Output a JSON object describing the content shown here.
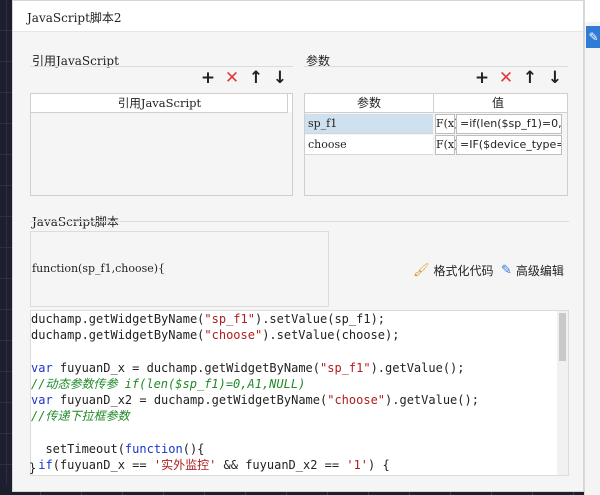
{
  "dialog": {
    "title": "JavaScript脚本2"
  },
  "references": {
    "section_label": "引用JavaScript",
    "column_header": "引用JavaScript",
    "toolbar": {
      "add_icon": "plus-icon",
      "delete_icon": "close-icon",
      "up_icon": "arrow-up-icon",
      "down_icon": "arrow-down-icon"
    }
  },
  "params": {
    "section_label": "参数",
    "col_name": "参数",
    "col_value": "值",
    "rows": [
      {
        "name": "sp_f1",
        "fx": "F(x)",
        "value": "=if(len($sp_f1)=0,A"
      },
      {
        "name": "choose",
        "fx": "F(x)",
        "value": "=IF($device_type="
      }
    ]
  },
  "script": {
    "section_label": "JavaScript脚本",
    "signature": "function(sp_f1,choose){",
    "format_label": "格式化代码",
    "advanced_label": "高级编辑",
    "closing": "}",
    "lines": [
      "duchamp.getWidgetByName(\"sp_f1\").setValue(sp_f1);",
      "duchamp.getWidgetByName(\"choose\").setValue(choose);",
      "",
      "var fuyuanD_x = duchamp.getWidgetByName(\"sp_f1\").getValue();",
      "//动态参数传参 if(len($sp_f1)=0,A1,NULL)",
      "var fuyuanD_x2 = duchamp.getWidgetByName(\"choose\").getValue();",
      "//传递下拉框参数",
      "",
      "  setTimeout(function(){",
      " if(fuyuanD_x == '实外监控' && fuyuanD_x2 == '1') {"
    ]
  },
  "colors": {
    "accent": "#2f7bd7",
    "delete_red": "#e23b3b",
    "keyword": "#1a37c9",
    "string": "#b01d1d",
    "comment": "#1e8a28",
    "selected_row": "#cfe0ef"
  }
}
